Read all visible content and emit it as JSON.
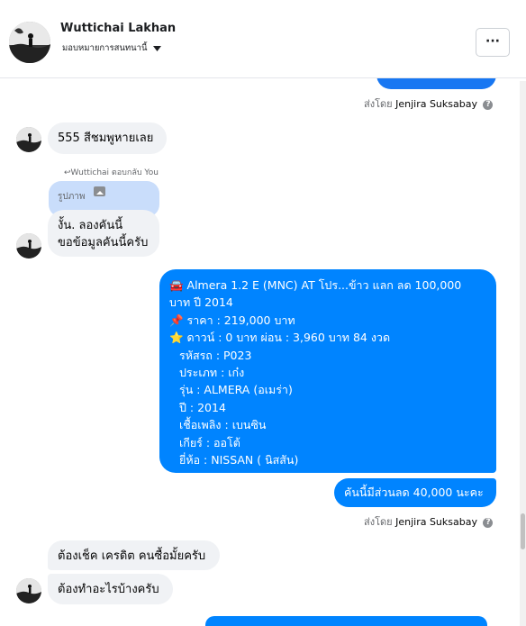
{
  "header": {
    "name": "Wuttichai Lakhan",
    "status": "มอบหมายการสนทนานี้",
    "more_label": "···"
  },
  "sent_by_label": "ส่งโดย",
  "sent_by_name": "Jenjira Suksabay",
  "info_glyph": "?",
  "messages": {
    "m1": "555 สีชมพูหายเลย",
    "reply_note": "Wuttichai ตอบกลับ You",
    "reply_quote": "รูปภาพ",
    "m2_line1": "งั้น. ลองคันนี้",
    "m2_line2": "ขอข้อมูลคันนี้ครับ",
    "listing": [
      "🚘 Almera 1.2 E (MNC) AT โปร...ข้าว แลก ลด 100,000",
      "บาท ปี 2014",
      "📌 ราคา : 219,000 บาท",
      "⭐ ดาวน์ : 0 บาท ผ่อน : 3,960 บาท 84 งวด",
      "รหัสรถ : P023",
      "ประเภท : เก๋ง",
      "รุ่น : ALMERA (อเมร่า)",
      "ปี : 2014",
      "เชื้อเพลิง : เบนซิน",
      "เกียร์ : ออโต้",
      "ยี่ห้อ : NISSAN ( นิสสัน)"
    ],
    "discount": "คันนี้มีส่วนลด 40,000 นะคะ",
    "m3": "ต้องเช็ค เครดิต คนซื้อมั้ยครับ",
    "m4": "ต้องทำอะไรบ้างครับ"
  },
  "colors": {
    "outgoing": "#0084ff",
    "incoming": "#f0f2f5",
    "reply_quote": "#c9ddfb"
  }
}
